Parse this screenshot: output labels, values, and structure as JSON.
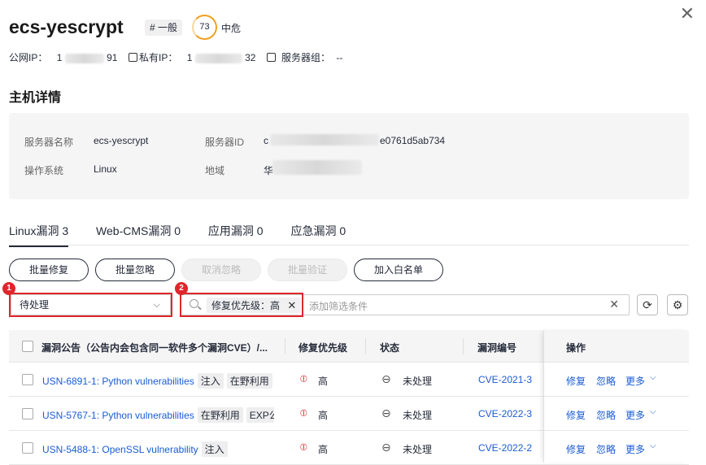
{
  "header": {
    "title": "ecs-yescrypt",
    "tag": "# 一般",
    "score": "73",
    "risk_level": "中危",
    "public_ip_label": "公网IP：",
    "public_ip_start": "1",
    "public_ip_end": "91",
    "private_ip_label": "私有IP：",
    "private_ip_start": "1",
    "private_ip_end": "32",
    "server_group_label": "服务器组：",
    "server_group_value": "--"
  },
  "details": {
    "heading": "主机详情",
    "server_name_label": "服务器名称",
    "server_name_value": "ecs-yescrypt",
    "server_id_label": "服务器ID",
    "server_id_start": "c",
    "server_id_end": "e0761d5ab734",
    "os_label": "操作系统",
    "os_value": "Linux",
    "region_label": "地域",
    "region_start": "华"
  },
  "tabs": [
    {
      "label": "Linux漏洞 3",
      "active": true
    },
    {
      "label": "Web-CMS漏洞 0",
      "active": false
    },
    {
      "label": "应用漏洞 0",
      "active": false
    },
    {
      "label": "应急漏洞 0",
      "active": false
    }
  ],
  "toolbar": {
    "batch_fix": "批量修复",
    "batch_ignore": "批量忽略",
    "cancel_ignore": "取消忽略",
    "batch_verify": "批量验证",
    "add_whitelist": "加入白名单"
  },
  "filters": {
    "status_value": "待处理",
    "chip_label": "修复优先级：高",
    "placeholder": "添加筛选条件",
    "marker_1": "1",
    "marker_2": "2"
  },
  "table": {
    "columns": [
      "漏洞公告（公告内会包含同一软件多个漏洞CVE）/...",
      "修复优先级",
      "状态",
      "漏洞编号",
      "操作"
    ],
    "rows": [
      {
        "name": "USN-6891-1: Python vulnerabilities",
        "tags": [
          "注入",
          "在野利用"
        ],
        "priority": "高",
        "status": "未处理",
        "cve": "CVE-2021-3",
        "actions": [
          "修复",
          "忽略",
          "更多"
        ]
      },
      {
        "name": "USN-5767-1: Python vulnerabilities",
        "tags": [
          "在野利用",
          "EXP公"
        ],
        "priority": "高",
        "status": "未处理",
        "cve": "CVE-2022-3",
        "actions": [
          "修复",
          "忽略",
          "更多"
        ]
      },
      {
        "name": "USN-5488-1: OpenSSL vulnerability",
        "tags": [
          "注入"
        ],
        "priority": "高",
        "status": "未处理",
        "cve": "CVE-2022-2",
        "actions": [
          "修复",
          "忽略",
          "更多"
        ]
      }
    ]
  },
  "colors": {
    "accent": "#1a5bd6",
    "danger": "#e0262c",
    "warning": "#f0a020"
  }
}
